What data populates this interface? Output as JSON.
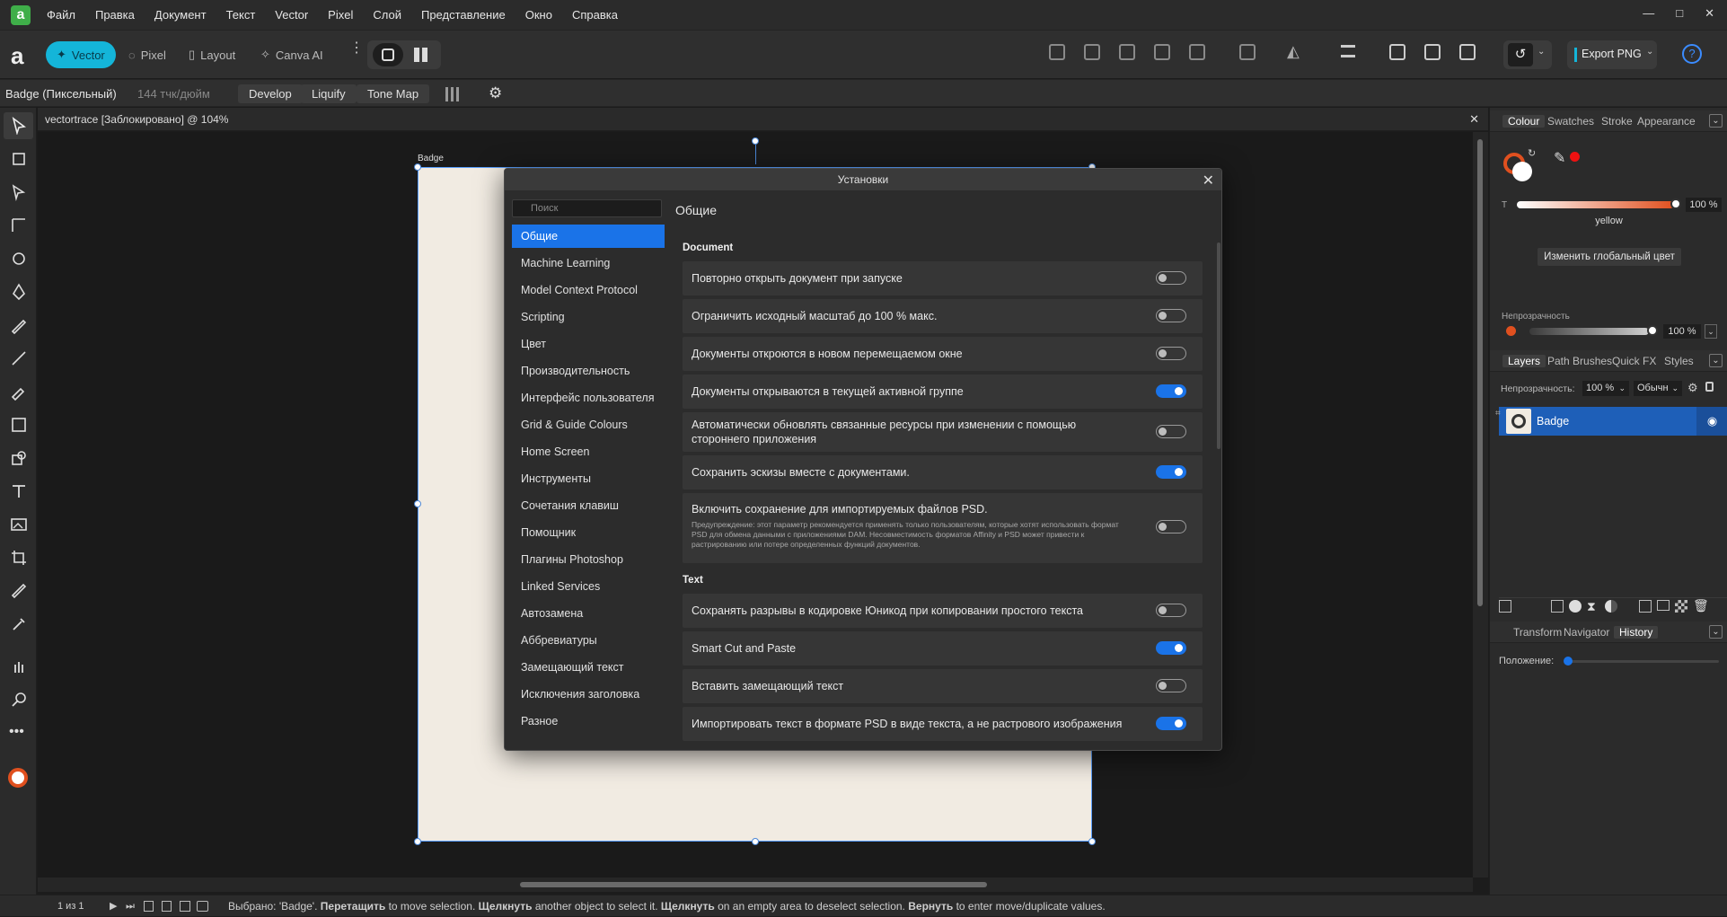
{
  "menubar": {
    "items": [
      "Файл",
      "Правка",
      "Документ",
      "Текст",
      "Vector",
      "Pixel",
      "Слой",
      "Представление",
      "Окно",
      "Справка"
    ],
    "window_controls": [
      "—",
      "□",
      "✕"
    ]
  },
  "toolbar": {
    "personas": [
      {
        "label": "Vector",
        "icon": "vector-persona-icon"
      },
      {
        "label": "Pixel",
        "icon": "pixel-persona-icon"
      },
      {
        "label": "Layout",
        "icon": "layout-persona-icon"
      },
      {
        "label": "Canva AI",
        "icon": "canva-ai-icon"
      }
    ],
    "export_label": "Export PNG",
    "help_label": "?"
  },
  "context": {
    "doc_name": "Badge (Пиксельный)",
    "dpi": "144 тчк/дюйм",
    "buttons": [
      "Develop",
      "Liquify",
      "Tone Map"
    ]
  },
  "document": {
    "tab_title": "vectortrace [Заблокировано] @ 104%",
    "artboard_label": "Badge"
  },
  "dialog": {
    "title": "Установки",
    "search_placeholder": "Поиск",
    "heading": "Общие",
    "nav": [
      "Общие",
      "Machine Learning",
      "Model Context Protocol",
      "Scripting",
      "Цвет",
      "Производительность",
      "Интерфейс пользователя",
      "Grid & Guide Colours",
      "Home Screen",
      "Инструменты",
      "Сочетания клавиш",
      "Помощник",
      "Плагины Photoshop",
      "Linked Services",
      "Автозамена",
      "Аббревиатуры",
      "Замещающий текст",
      "Исключения заголовка",
      "Разное"
    ],
    "sections": {
      "document_title": "Document",
      "text_title": "Text"
    },
    "document_options": [
      {
        "label": "Повторно открыть документ при запуске",
        "on": false
      },
      {
        "label": "Ограничить исходный масштаб до 100 % макс.",
        "on": false
      },
      {
        "label": "Документы откроются в новом перемещаемом окне",
        "on": false
      },
      {
        "label": "Документы открываются в текущей активной группе",
        "on": true
      },
      {
        "label": "Автоматически обновлять связанные ресурсы при изменении с помощью стороннего приложения",
        "on": false
      },
      {
        "label": "Сохранить эскизы вместе с документами.",
        "on": true
      },
      {
        "label": "Включить сохранение для импортируемых файлов PSD.",
        "on": false,
        "note": "Предупреждение: этот параметр рекомендуется применять только пользователям, которые хотят использовать формат PSD для обмена данными с приложениями DAM. Несовместимость форматов Affinity и PSD может привести к растрированию или потере определенных функций документов."
      }
    ],
    "text_options": [
      {
        "label": "Сохранять разрывы в кодировке Юникод при копировании простого текста",
        "on": false
      },
      {
        "label": "Smart Cut and Paste",
        "on": true
      },
      {
        "label": "Вставить замещающий текст",
        "on": false
      },
      {
        "label": "Импортировать текст в формате PSD в виде текста, а не растрового изображения",
        "on": true
      }
    ]
  },
  "colour_panel": {
    "tabs": [
      "Colour",
      "Swatches",
      "Stroke",
      "Appearance"
    ],
    "t_label": "T",
    "t_value": "100 %",
    "colour_name": "yellow",
    "global_button": "Изменить глобальный цвет",
    "opacity_label": "Непрозрачность",
    "opacity_value": "100 %",
    "accent": "#e0501f"
  },
  "layers_panel": {
    "tabs": [
      "Layers",
      "Path Brushes",
      "Quick FX",
      "Styles"
    ],
    "opacity_label": "Непрозрачность:",
    "opacity_value": "100 %",
    "blend_mode": "Обычн",
    "layer_name": "Badge"
  },
  "history_panel": {
    "tabs": [
      "Transform",
      "Navigator",
      "History"
    ],
    "position_label": "Положение:"
  },
  "status": {
    "page": "1 из 1",
    "message_parts": [
      {
        "text": "Выбрано: 'Badge'. ",
        "bold": false
      },
      {
        "text": "Перетащить",
        "bold": true
      },
      {
        "text": " to move selection. ",
        "bold": false
      },
      {
        "text": "Щелкнуть",
        "bold": true
      },
      {
        "text": " another object to select it. ",
        "bold": false
      },
      {
        "text": "Щелкнуть",
        "bold": true
      },
      {
        "text": " on an empty area to deselect selection. ",
        "bold": false
      },
      {
        "text": "Вернуть",
        "bold": true
      },
      {
        "text": " to enter move/duplicate values.",
        "bold": false
      }
    ]
  }
}
